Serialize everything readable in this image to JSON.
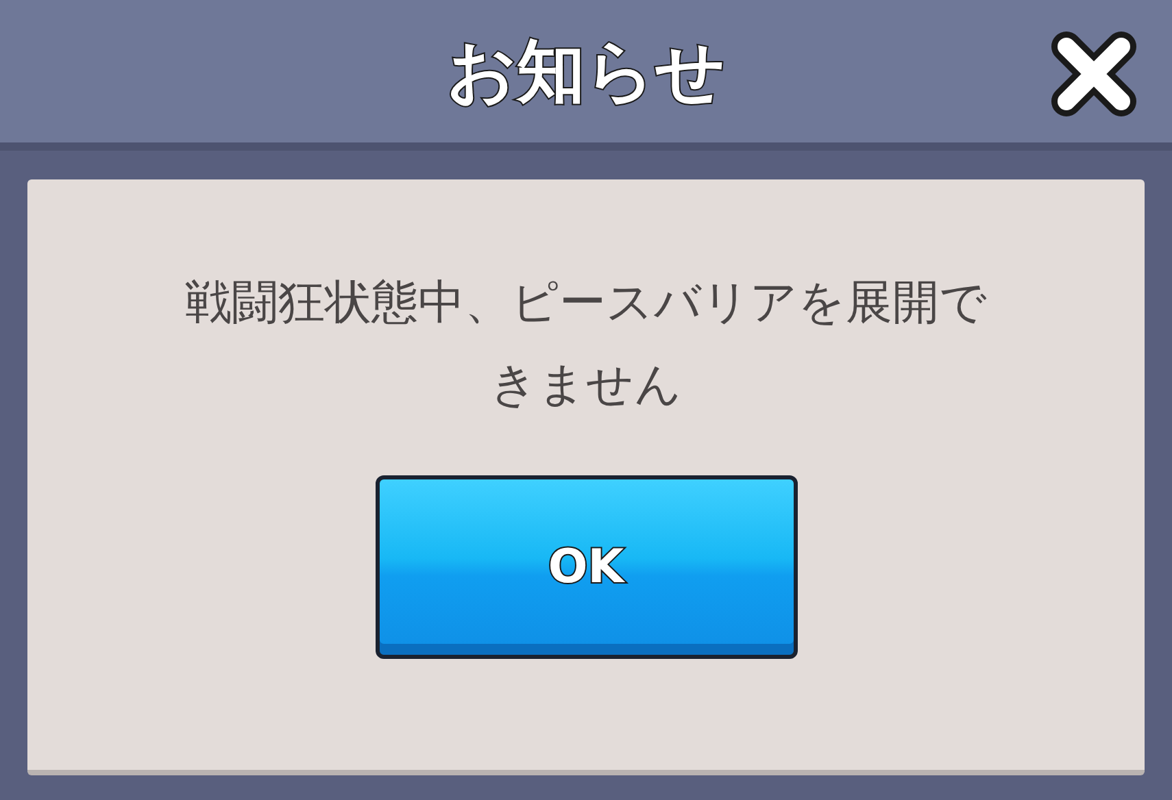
{
  "dialog": {
    "title": "お知らせ",
    "message": "戦闘狂状態中、ピースバリアを展開できません",
    "buttons": [
      {
        "label": "OK"
      }
    ]
  }
}
